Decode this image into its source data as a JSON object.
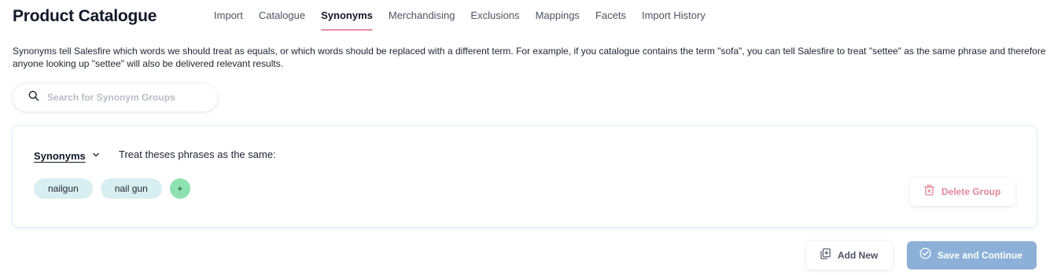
{
  "header": {
    "title": "Product Catalogue",
    "tabs": [
      {
        "label": "Import"
      },
      {
        "label": "Catalogue"
      },
      {
        "label": "Synonyms"
      },
      {
        "label": "Merchandising"
      },
      {
        "label": "Exclusions"
      },
      {
        "label": "Mappings"
      },
      {
        "label": "Facets"
      },
      {
        "label": "Import History"
      }
    ],
    "active_tab": "Synonyms"
  },
  "description": "Synonyms tell Salesfire which words we should treat as equals, or which words should be replaced with a different term. For example, if you catalogue contains the term \"sofa\", you can tell Salesfire to treat \"settee\" as the same phrase and therefore anyone looking up \"settee\" will also be delivered relevant results.",
  "search": {
    "placeholder": "Search for Synonym Groups",
    "value": "",
    "icon": "search-icon"
  },
  "group": {
    "type_label": "Synonyms",
    "type_icon": "chevron-down-icon",
    "description": "Treat theses phrases as the same:",
    "phrases": [
      "nailgun",
      "nail gun"
    ],
    "add_label": "+",
    "delete_label": "Delete Group",
    "delete_icon": "trash-icon"
  },
  "footer": {
    "add_new_label": "Add New",
    "add_new_icon": "copy-add-icon",
    "save_label": "Save and Continue",
    "save_icon": "check-circle-icon"
  },
  "colors": {
    "active_tab_underline": "#e98ea3",
    "chip_bg": "#d8eff2",
    "add_chip_bg": "#8ee2b2",
    "delete_text": "#e2879a",
    "save_bg": "#8cb0d8"
  }
}
